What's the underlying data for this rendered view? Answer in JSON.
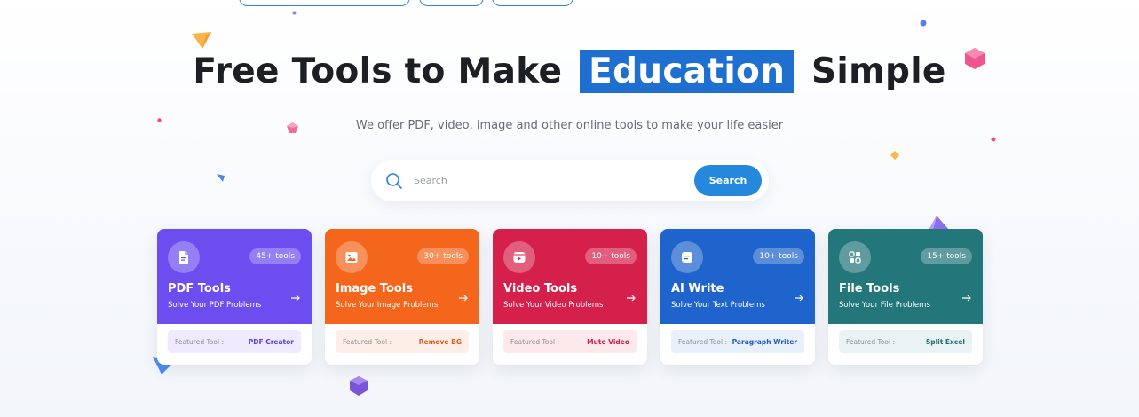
{
  "hero": {
    "title_before": "Free Tools to Make",
    "title_highlight": "Education",
    "title_after": "Simple",
    "subtitle": "We offer PDF, video, image and other online tools to make your life easier"
  },
  "search": {
    "placeholder": "Search",
    "button_label": "Search"
  },
  "colors": {
    "highlight": "#1f6fd1",
    "search_button": "#2488dc"
  },
  "cards": [
    {
      "title": "PDF Tools",
      "subtitle": "Solve Your PDF Problems",
      "count": "45+ tools",
      "featured_label": "Featured Tool :",
      "featured_tool": "PDF Creator",
      "color": "#6c4ef0",
      "icon": "pdf-icon"
    },
    {
      "title": "Image Tools",
      "subtitle": "Solve Your Image Problems",
      "count": "30+ tools",
      "featured_label": "Featured Tool :",
      "featured_tool": "Remove BG",
      "color": "#f4661c",
      "icon": "image-icon"
    },
    {
      "title": "Video Tools",
      "subtitle": "Solve Your Video Problems",
      "count": "10+ tools",
      "featured_label": "Featured Tool :",
      "featured_tool": "Mute Video",
      "color": "#d6204c",
      "icon": "video-icon"
    },
    {
      "title": "AI Write",
      "subtitle": "Solve Your Text Problems",
      "count": "10+ tools",
      "featured_label": "Featured Tool :",
      "featured_tool": "Paragraph Writer",
      "color": "#1f63cc",
      "icon": "ai-write-icon"
    },
    {
      "title": "File Tools",
      "subtitle": "Solve Your File Problems",
      "count": "15+ tools",
      "featured_label": "Featured Tool :",
      "featured_tool": "Split Excel",
      "color": "#23777a",
      "icon": "file-icon"
    }
  ]
}
